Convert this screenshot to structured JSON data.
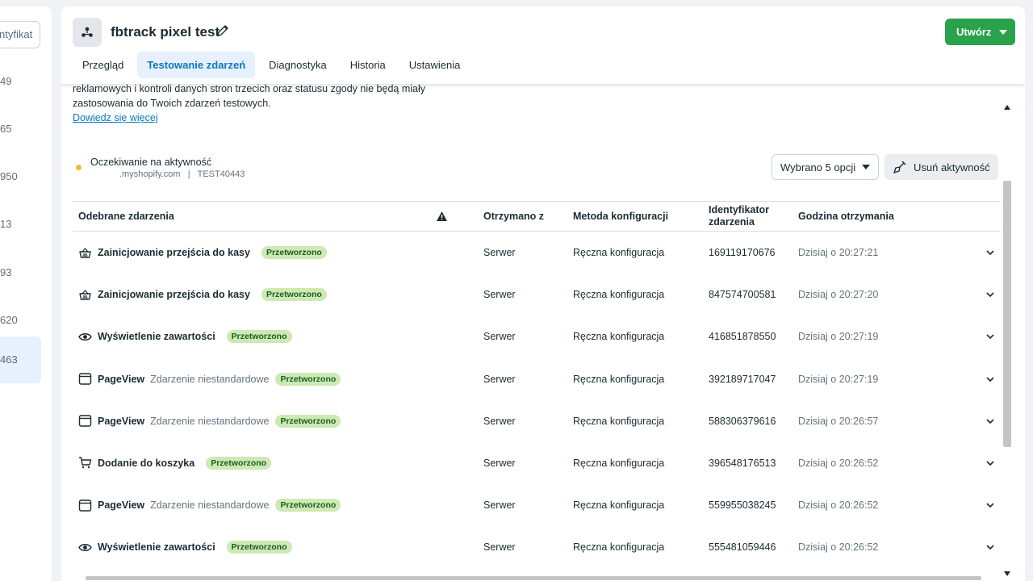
{
  "sidebar": {
    "search_placeholder": "ntyfikat",
    "items": [
      {
        "label": "49"
      },
      {
        "label": "65"
      },
      {
        "label": "950"
      },
      {
        "label": "13"
      },
      {
        "label": "93"
      },
      {
        "label": "620"
      },
      {
        "label": "463"
      }
    ]
  },
  "header": {
    "title": "fbtrack pixel test",
    "create_label": "Utwórz",
    "tabs": [
      {
        "label": "Przegląd"
      },
      {
        "label": "Testowanie zdarzeń"
      },
      {
        "label": "Diagnostyka"
      },
      {
        "label": "Historia"
      },
      {
        "label": "Ustawienia"
      }
    ]
  },
  "info": {
    "line1": "reklamowych i kontroli danych stron trzecich oraz statusu zgody nie będą miały",
    "line2": "zastosowania do Twoich zdarzeń testowych.",
    "learn_more": "Dowiedz się więcej"
  },
  "status": {
    "title": "Oczekiwanie na aktywność",
    "domain": ".myshopify.com",
    "separator": "|",
    "code": "TEST40443"
  },
  "controls": {
    "select_label": "Wybrano 5 opcji",
    "clear_label": "Usuń aktywność"
  },
  "table": {
    "headers": {
      "event": "Odebrane zdarzenia",
      "received_from": "Otrzymano z",
      "method": "Metoda konfiguracji",
      "event_id": "Identyfikator zdarzenia",
      "time": "Godzina otrzymania"
    },
    "rows": [
      {
        "icon": "shopping-basket-icon",
        "name": "Zainicjowanie przejścia do kasy",
        "sub": "",
        "badge": "Przetworzono",
        "from": "Serwer",
        "method": "Ręczna konfiguracja",
        "id": "169119170676",
        "time": "Dzisiaj o 20:27:21"
      },
      {
        "icon": "shopping-basket-icon",
        "name": "Zainicjowanie przejścia do kasy",
        "sub": "",
        "badge": "Przetworzono",
        "from": "Serwer",
        "method": "Ręczna konfiguracja",
        "id": "847574700581",
        "time": "Dzisiaj o 20:27:20"
      },
      {
        "icon": "eye-icon",
        "name": "Wyświetlenie zawartości",
        "sub": "",
        "badge": "Przetworzono",
        "from": "Serwer",
        "method": "Ręczna konfiguracja",
        "id": "416851878550",
        "time": "Dzisiaj o 20:27:19"
      },
      {
        "icon": "browser-window-icon",
        "name": "PageView",
        "sub": "Zdarzenie niestandardowe",
        "badge": "Przetworzono",
        "from": "Serwer",
        "method": "Ręczna konfiguracja",
        "id": "392189717047",
        "time": "Dzisiaj o 20:27:19"
      },
      {
        "icon": "browser-window-icon",
        "name": "PageView",
        "sub": "Zdarzenie niestandardowe",
        "badge": "Przetworzono",
        "from": "Serwer",
        "method": "Ręczna konfiguracja",
        "id": "588306379616",
        "time": "Dzisiaj o 20:26:57"
      },
      {
        "icon": "shopping-cart-icon",
        "name": "Dodanie do koszyka",
        "sub": "",
        "badge": "Przetworzono",
        "from": "Serwer",
        "method": "Ręczna konfiguracja",
        "id": "396548176513",
        "time": "Dzisiaj o 20:26:52"
      },
      {
        "icon": "browser-window-icon",
        "name": "PageView",
        "sub": "Zdarzenie niestandardowe",
        "badge": "Przetworzono",
        "from": "Serwer",
        "method": "Ręczna konfiguracja",
        "id": "559955038245",
        "time": "Dzisiaj o 20:26:52"
      },
      {
        "icon": "eye-icon",
        "name": "Wyświetlenie zawartości",
        "sub": "",
        "badge": "Przetworzono",
        "from": "Serwer",
        "method": "Ręczna konfiguracja",
        "id": "555481059446",
        "time": "Dzisiaj o 20:26:52"
      }
    ]
  },
  "colors": {
    "accent": "#0a78be",
    "create_button": "#2aa14b",
    "badge_bg": "#cde9b4",
    "status_dot": "#f7b928"
  }
}
